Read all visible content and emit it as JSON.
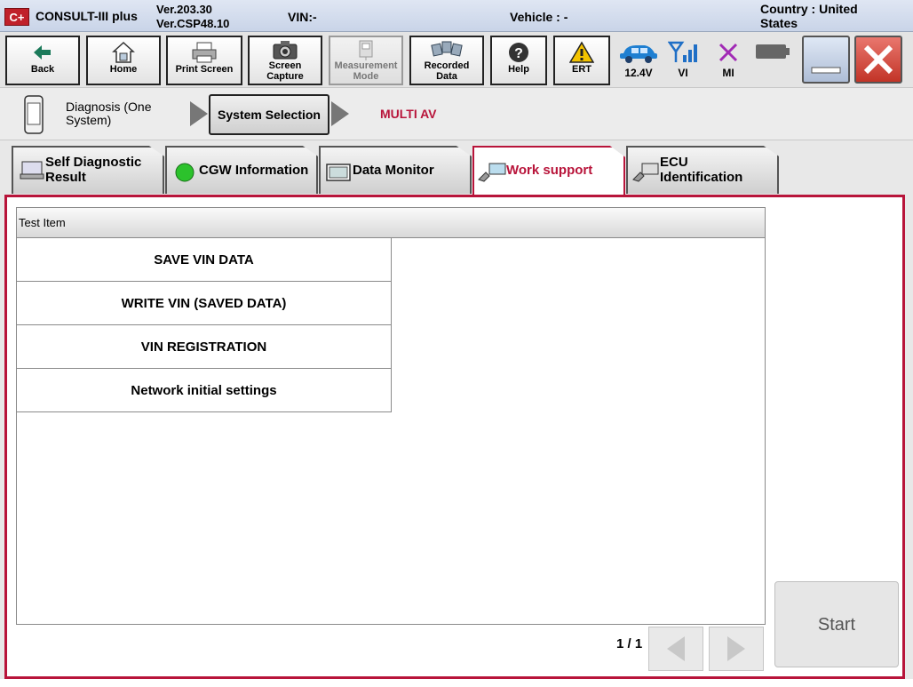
{
  "titlebar": {
    "logo": "C+",
    "app_name": "CONSULT-III plus",
    "ver1": "Ver.203.30",
    "ver2": "Ver.CSP48.10",
    "vin": "VIN:-",
    "vehicle": "Vehicle : -",
    "country1": "Country : United",
    "country2": "States"
  },
  "toolbar": {
    "back": "Back",
    "home": "Home",
    "print": "Print Screen",
    "capture1": "Screen",
    "capture2": "Capture",
    "measure1": "Measurement",
    "measure2": "Mode",
    "recorded1": "Recorded",
    "recorded2": "Data",
    "help": "Help",
    "ert": "ERT",
    "voltage": "12.4V",
    "vi": "VI",
    "mi": "MI"
  },
  "breadcrumb": {
    "item1_line1": "Diagnosis (One",
    "item1_line2": "System)",
    "item2": "System Selection",
    "item3": "MULTI AV"
  },
  "tabs": {
    "self_diag1": "Self Diagnostic",
    "self_diag2": "Result",
    "cgw": "CGW Information",
    "data_monitor": "Data Monitor",
    "work_support": "Work support",
    "ecu1": "ECU",
    "ecu2": "Identification"
  },
  "list": {
    "header": "Test Item",
    "items": [
      "SAVE VIN DATA",
      "WRITE VIN (SAVED DATA)",
      "VIN REGISTRATION",
      "Network initial settings"
    ]
  },
  "pager": {
    "text": "1 / 1"
  },
  "start_label": "Start",
  "colors": {
    "accent": "#b8143a",
    "title_bg": "#c9d4e8"
  }
}
